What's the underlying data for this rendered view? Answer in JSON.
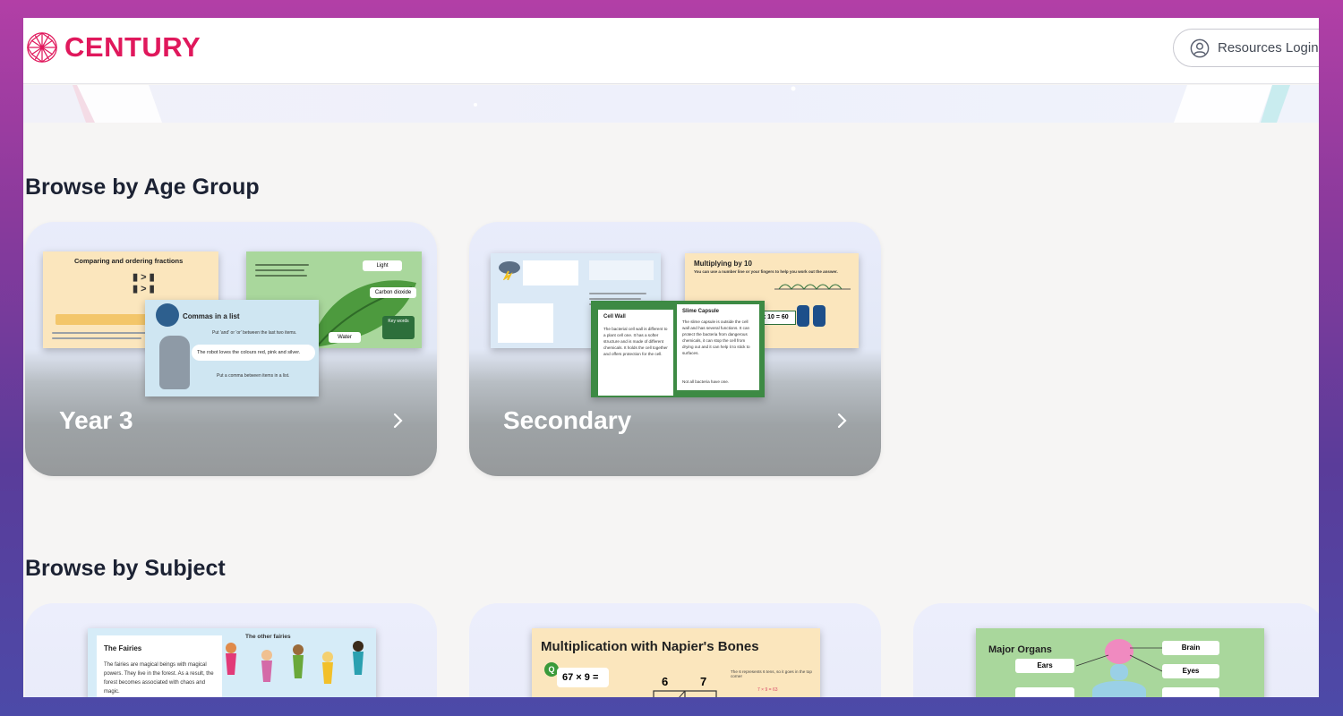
{
  "header": {
    "brand": "CENTURY",
    "login_label": "Resources Login"
  },
  "age_section": {
    "title": "Browse by Age Group",
    "cards": [
      {
        "label": "Year 3",
        "slides": {
          "a_title": "Comparing and ordering fractions",
          "b_title": "Commas in a list",
          "b_line1": "Put 'and' or 'or' between the last two items.",
          "b_line2": "The robot loves the colours red, pink and silver.",
          "b_line3": "Put a comma between items in a list.",
          "c_tag1": "Light",
          "c_tag2": "Carbon dioxide",
          "c_tag3": "Water",
          "c_tag4": "Key words"
        }
      },
      {
        "label": "Secondary",
        "slides": {
          "a_title": "Multiplying by 10",
          "a_sub": "You can use a number line or your fingers to help you work out the answer.",
          "a_calc": "x 10 = 60",
          "b_title": "Cell Wall",
          "b_text": "The bacterial cell wall is different to a plant cell one. It has a softer structure and is made of different chemicals. It holds the cell together and offers protection for the cell.",
          "c_title": "Slime Capsule",
          "c_text": "The slime capsule is outside the cell wall and has several functions. It can protect the bacteria from dangerous chemicals, it can stop the cell from drying out and it can help it to stick to surfaces.",
          "c_note": "Not all bacteria have one."
        }
      }
    ]
  },
  "subject_section": {
    "title": "Browse by Subject",
    "cards": [
      {
        "slide_title": "The Fairies",
        "slide_tag": "The other fairies",
        "slide_text": "The fairies are magical beings with magical powers. They live in the forest. As a result, the forest becomes associated with chaos and magic."
      },
      {
        "slide_title": "Multiplication with Napier's Bones",
        "q_badge": "Q",
        "expr": "67 × 9 =",
        "num1": "6",
        "num2": "7",
        "note": "The 6 represents 6 tens, so it goes in the top corner",
        "calc": "7 × 9 = 63"
      },
      {
        "slide_title": "Major Organs",
        "labels": [
          "Brain",
          "Ears",
          "Eyes"
        ]
      }
    ]
  },
  "colors": {
    "brand": "#e0185c",
    "heading": "#1c2233"
  }
}
